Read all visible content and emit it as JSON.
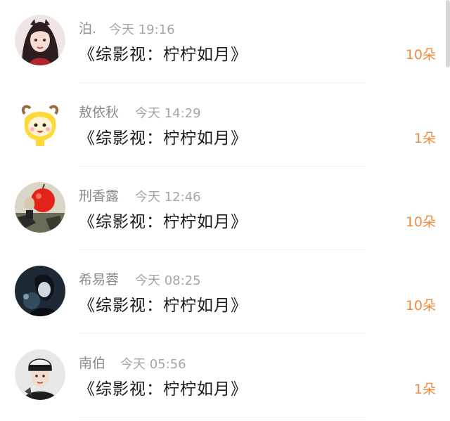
{
  "messages": [
    {
      "name": "泊.",
      "time": "今天 19:16",
      "title": "《综影视：柠柠如月》",
      "gift": "10朵",
      "avatar": "girl-portrait-avatar"
    },
    {
      "name": "敖依秋",
      "time": "今天 14:29",
      "title": "《综影视：柠柠如月》",
      "gift": "1朵",
      "avatar": "yellow-cartoon-avatar"
    },
    {
      "name": "刑香露",
      "time": "今天 12:46",
      "title": "《综影视：柠柠如月》",
      "gift": "10朵",
      "avatar": "red-apple-avatar"
    },
    {
      "name": "希易蓉",
      "time": "今天 08:25",
      "title": "《综影视：柠柠如月》",
      "gift": "10朵",
      "avatar": "dark-anime-avatar"
    },
    {
      "name": "南伯",
      "time": "今天 05:56",
      "title": "《综影视：柠柠如月》",
      "gift": "1朵",
      "avatar": "boy-beanie-avatar"
    }
  ],
  "colors": {
    "gift": "#f08a3c",
    "name": "#8a8a8a",
    "time": "#a6a6a6",
    "title": "#1a1a1a"
  }
}
